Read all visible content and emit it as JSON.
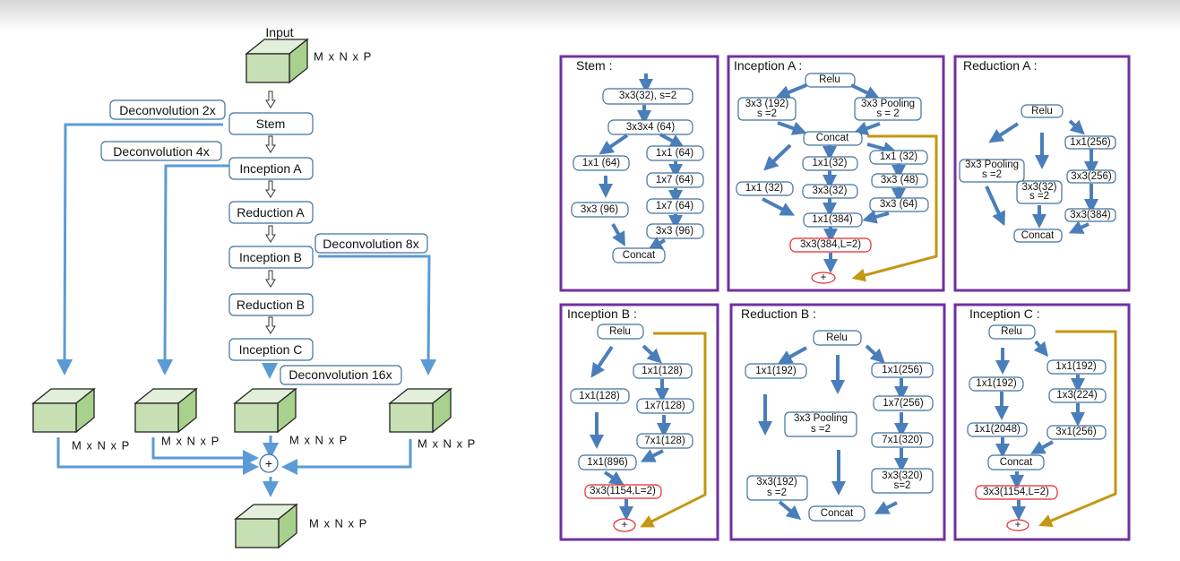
{
  "main_flow": {
    "input_label": "Input",
    "dim_label": "M x N x P",
    "blocks": [
      "Stem",
      "Inception  A",
      "Reduction  A",
      "Inception  B",
      "Reduction  B",
      "Inception  C"
    ],
    "deconv": [
      "Deconvolution 2x",
      "Deconvolution 4x",
      "Deconvolution 8x",
      "Deconvolution 16x"
    ],
    "sum_symbol": "+"
  },
  "panels": {
    "stem": {
      "title": "Stem :",
      "nodes": [
        "3x3(32), s=2",
        "3x3x4 (64)",
        "1x1 (64)",
        "3x3 (96)",
        "1x1 (64)",
        "1x7 (64)",
        "1x7 (64)",
        "3x3 (96)",
        "Concat"
      ]
    },
    "inception_a": {
      "title": "Inception  A :",
      "nodes": [
        "Relu",
        "3x3 (192)",
        "s =2",
        "3x3 Pooling",
        "s = 2",
        "Concat",
        "1x1 (32)",
        "1x1(32)",
        "3x3(32)",
        "1x1 (32)",
        "3x3 (48)",
        "3x3 (64)",
        "1x1(384)",
        "3x3(384,L=2)",
        "+"
      ]
    },
    "reduction_a": {
      "title": "Reduction  A :",
      "nodes": [
        "Relu",
        "3x3 Pooling",
        "s =2",
        "3x3(32)",
        "s =2",
        "1x1(256)",
        "3x3(256)",
        "3x3(384)",
        "Concat"
      ]
    },
    "inception_b": {
      "title": "Inception  B :",
      "nodes": [
        "Relu",
        "1x1(128)",
        "1x1(128)",
        "1x7(128)",
        "7x1(128)",
        "1x1(896)",
        "3x3(1154,L=2)",
        "+"
      ]
    },
    "reduction_b": {
      "title": "Reduction  B :",
      "nodes": [
        "Relu",
        "1x1(192)",
        "3x3 Pooling",
        "s =2",
        "1x1(256)",
        "1x7(256)",
        "7x1(320)",
        "3x3(192)",
        "s =2",
        "3x3(320)",
        "s=2",
        "Concat"
      ]
    },
    "inception_c": {
      "title": "Inception  C :",
      "nodes": [
        "Relu",
        "1x1(192)",
        "1x1(2048)",
        "1x1(192)",
        "1x3(224)",
        "3x1(256)",
        "Concat",
        "3x3(1154,L=2)",
        "+"
      ]
    }
  },
  "colors": {
    "panel_border": "#7030a0",
    "skip_line": "#5b9bd5",
    "residual_line": "#c39712",
    "highlight_node": "#e8262b",
    "cube_front": "#c6e0b4",
    "cube_top": "#e2efda",
    "cube_side": "#a9d18e"
  }
}
